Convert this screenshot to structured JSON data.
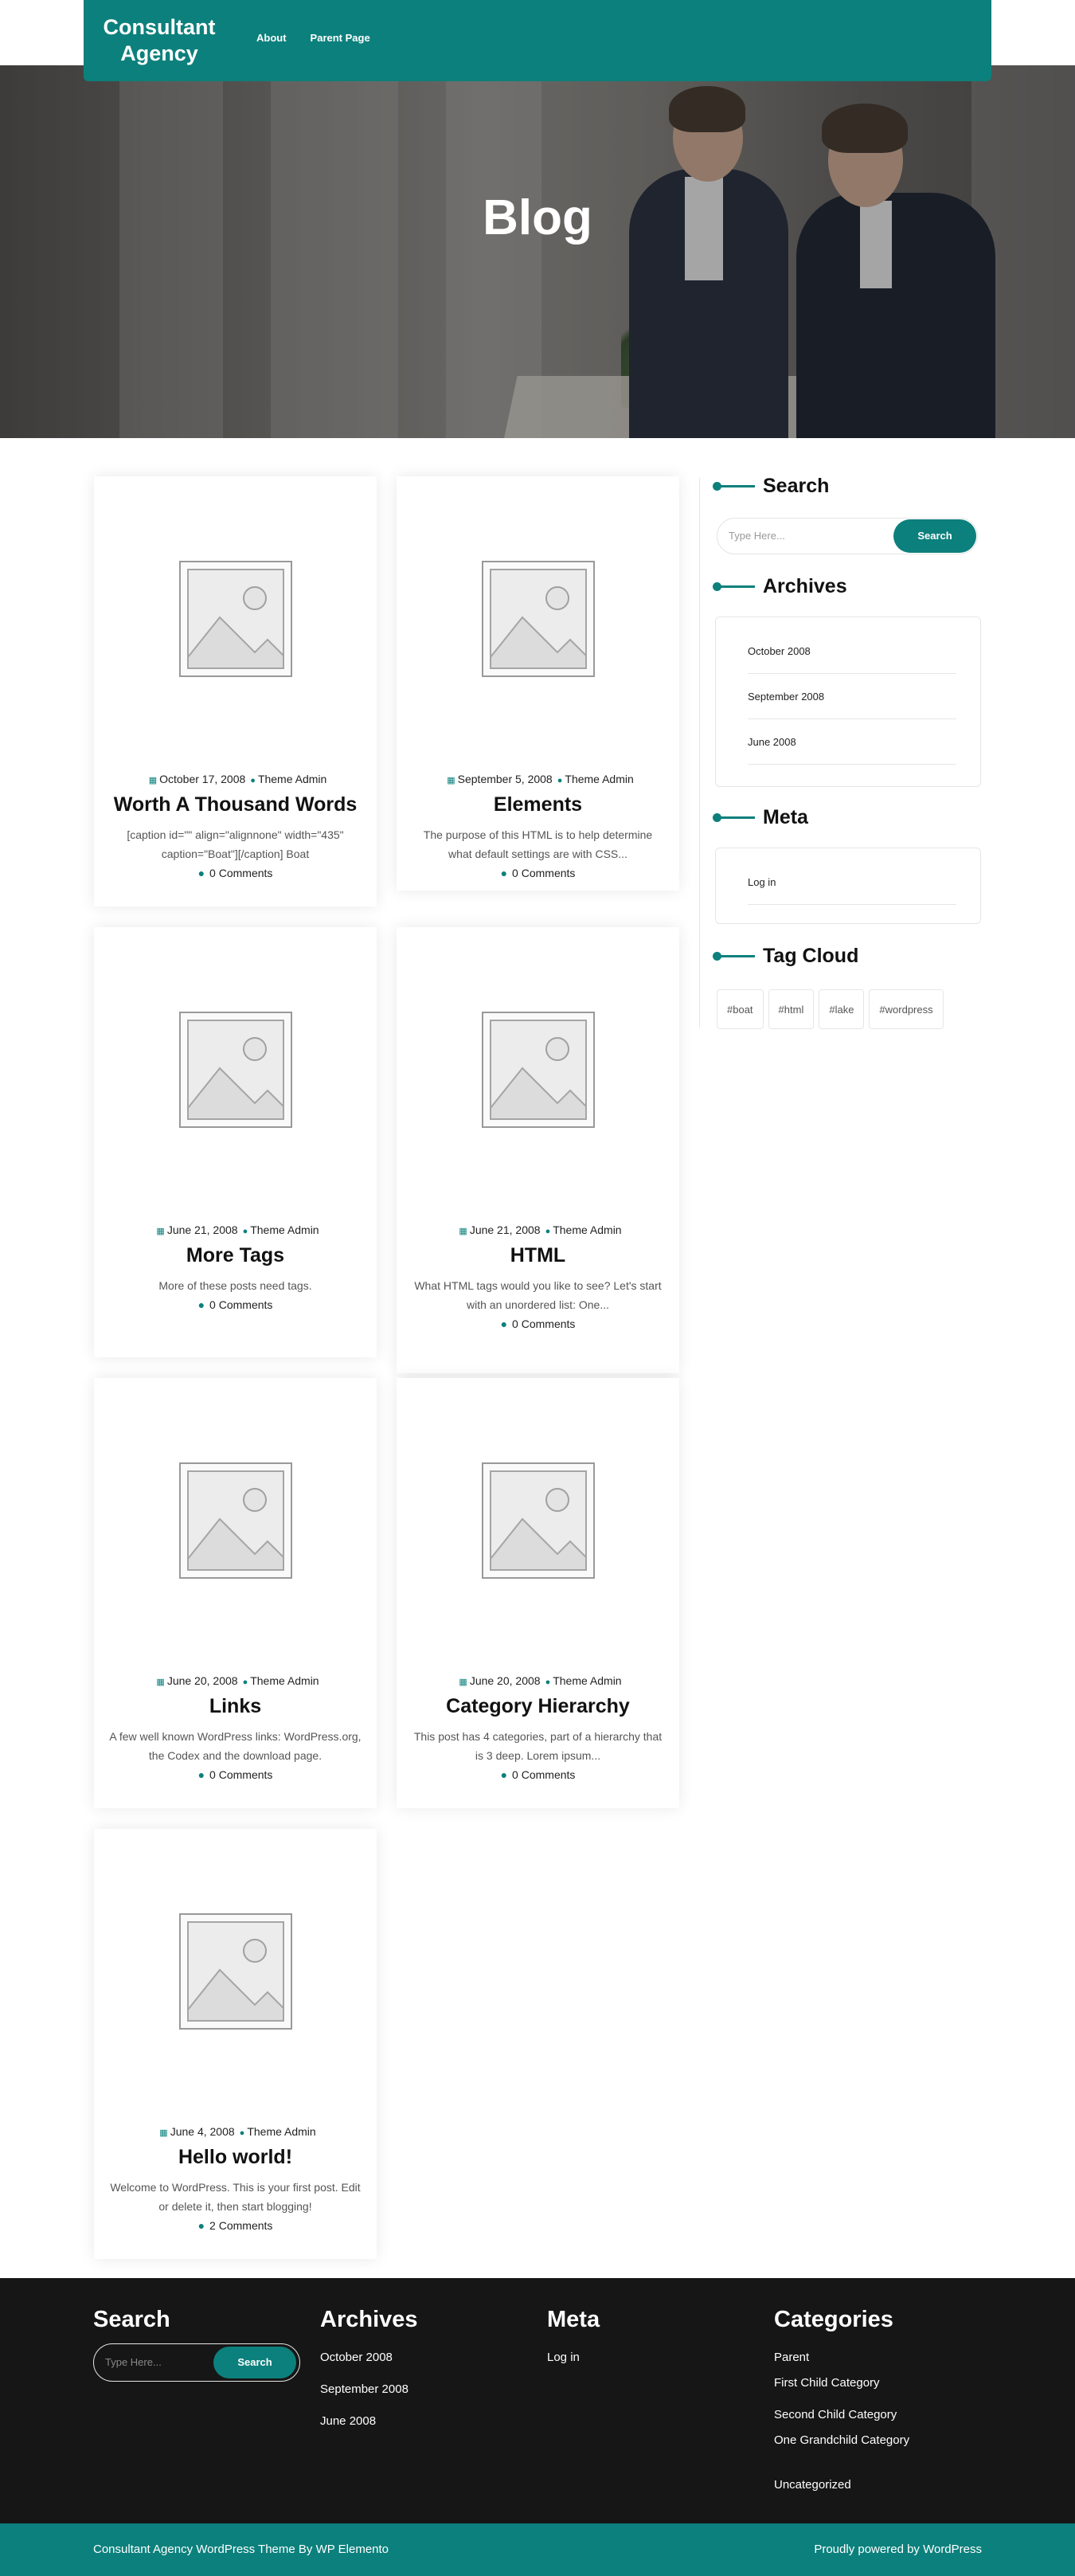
{
  "header": {
    "logo": "Consultant Agency",
    "nav": [
      "About",
      "Parent Page"
    ]
  },
  "hero": {
    "title": "Blog"
  },
  "posts": [
    {
      "date": "October 17, 2008",
      "author": "Theme Admin",
      "title": "Worth A Thousand Words",
      "excerpt": "[caption id=\"\" align=\"alignnone\" width=\"435\" caption=\"Boat\"][/caption] Boat",
      "comments": "0 Comments"
    },
    {
      "date": "September 5, 2008",
      "author": "Theme Admin",
      "title": "Elements",
      "excerpt": "The purpose of this HTML is to help determine what default settings are with CSS...",
      "comments": "0 Comments"
    },
    {
      "date": "June 21, 2008",
      "author": "Theme Admin",
      "title": "More Tags",
      "excerpt": "More of these posts need tags.",
      "comments": "0 Comments"
    },
    {
      "date": "June 21, 2008",
      "author": "Theme Admin",
      "title": "HTML",
      "excerpt": "What HTML tags would you like to see? Let's start with an unordered list: One...",
      "comments": "0 Comments"
    },
    {
      "date": "June 20, 2008",
      "author": "Theme Admin",
      "title": "Links",
      "excerpt": "A few well known WordPress links: WordPress.org, the Codex and the download page.",
      "comments": "0 Comments"
    },
    {
      "date": "June 20, 2008",
      "author": "Theme Admin",
      "title": "Category Hierarchy",
      "excerpt": "This post has 4 categories, part of a hierarchy that is 3 deep. Lorem ipsum...",
      "comments": "0 Comments"
    },
    {
      "date": "June 4, 2008",
      "author": "Theme Admin",
      "title": "Hello world!",
      "excerpt": "Welcome to WordPress. This is your first post. Edit or delete it, then start blogging!",
      "comments": "2 Comments"
    }
  ],
  "sidebar": {
    "search": {
      "title": "Search",
      "placeholder": "Type Here...",
      "button": "Search"
    },
    "archives": {
      "title": "Archives",
      "items": [
        "October 2008",
        "September 2008",
        "June 2008"
      ]
    },
    "meta": {
      "title": "Meta",
      "items": [
        "Log in"
      ]
    },
    "tags": {
      "title": "Tag Cloud",
      "items": [
        "#boat",
        "#html",
        "#lake",
        "#wordpress"
      ]
    }
  },
  "footer": {
    "search": {
      "title": "Search",
      "placeholder": "Type Here...",
      "button": "Search"
    },
    "archives": {
      "title": "Archives",
      "items": [
        "October 2008",
        "September 2008",
        "June 2008"
      ]
    },
    "meta": {
      "title": "Meta",
      "items": [
        "Log in"
      ]
    },
    "categories": {
      "title": "Categories",
      "items": [
        "Parent",
        "First Child Category",
        "Second Child Category",
        "One Grandchild Category",
        "Uncategorized"
      ]
    },
    "copyright_left": "Consultant Agency WordPress Theme By WP Elemento",
    "copyright_right": "Proudly powered by WordPress"
  },
  "colors": {
    "accent": "#0c807c",
    "footer_bg": "#171616"
  }
}
